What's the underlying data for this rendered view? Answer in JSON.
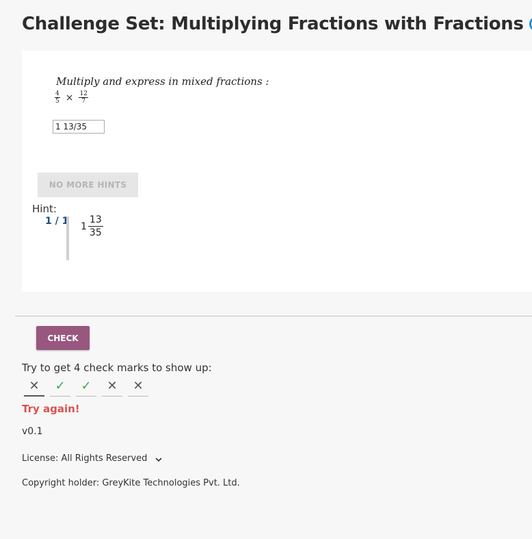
{
  "header": {
    "title": "Challenge Set: Multiplying Fractions with Fractions",
    "clock_icon": "clock-icon",
    "accent_color": "#1a8fd6"
  },
  "question": {
    "instruction": "Multiply and express in mixed fractions :",
    "fraction_a": {
      "numerator": "4",
      "denominator": "5"
    },
    "operator": "×",
    "fraction_b": {
      "numerator": "12",
      "denominator": "7"
    },
    "answer_value": "1 13/35"
  },
  "hints": {
    "button_label": "NO MORE HINTS",
    "label": "Hint:",
    "counter": "1 / 1",
    "answer": {
      "whole": "1",
      "numerator": "13",
      "denominator": "35"
    }
  },
  "check": {
    "button_label": "CHECK",
    "button_color": "#98577e",
    "instruction": "Try to get 4 check marks to show up:",
    "marks": [
      {
        "status": "wrong",
        "symbol": "✕"
      },
      {
        "status": "correct",
        "symbol": "✓"
      },
      {
        "status": "correct",
        "symbol": "✓"
      },
      {
        "status": "wrong",
        "symbol": "✕"
      },
      {
        "status": "wrong",
        "symbol": "✕"
      }
    ],
    "result": "Try again!",
    "result_color": "#d9534f"
  },
  "footer": {
    "version": "v0.1",
    "license": "License: All Rights Reserved",
    "copyright": "Copyright holder: GreyKite Technologies Pvt. Ltd."
  }
}
